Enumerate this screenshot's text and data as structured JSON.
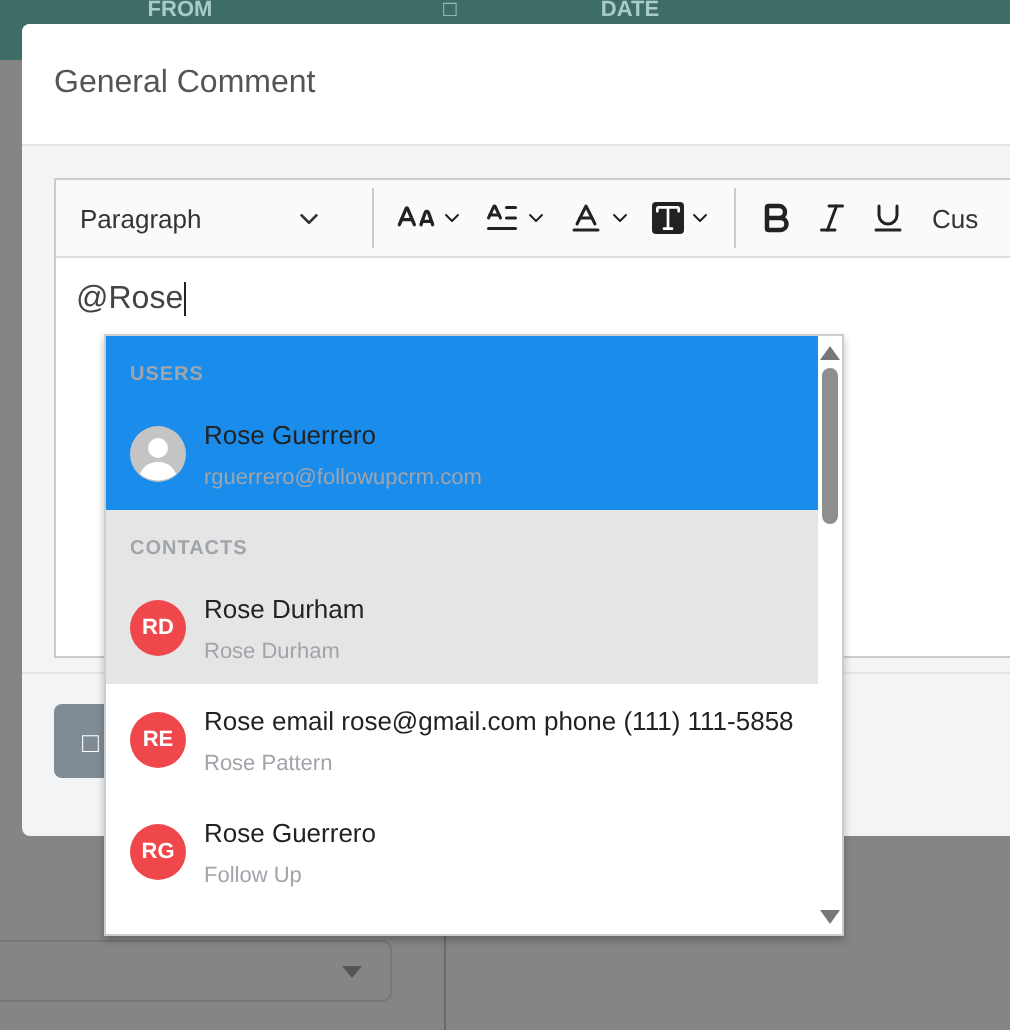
{
  "background": {
    "header_columns": [
      "FROM",
      "□",
      "DATE"
    ]
  },
  "dialog": {
    "title": "General Comment",
    "toolbar": {
      "block_format": "Paragraph",
      "overflow_label": "Cus"
    },
    "editor_text": "@Rose",
    "footer_button": "□"
  },
  "mention_dropdown": {
    "sections": [
      {
        "heading": "USERS",
        "items": [
          {
            "name": "Rose Guerrero",
            "detail": "rguerrero@followupcrm.com",
            "kind": "photo",
            "selected": true,
            "hovered": false
          }
        ]
      },
      {
        "heading": "CONTACTS",
        "items": [
          {
            "name": "Rose Durham",
            "detail": "Rose Durham",
            "kind": "initials",
            "initials": "RD",
            "selected": false,
            "hovered": true
          },
          {
            "name": "Rose email rose@gmail.com phone (111) 111-5858",
            "detail": "Rose Pattern",
            "kind": "initials",
            "initials": "RE",
            "selected": false,
            "hovered": false
          },
          {
            "name": "Rose Guerrero",
            "detail": "Follow Up",
            "kind": "initials",
            "initials": "RG",
            "selected": false,
            "hovered": false
          }
        ]
      }
    ]
  }
}
